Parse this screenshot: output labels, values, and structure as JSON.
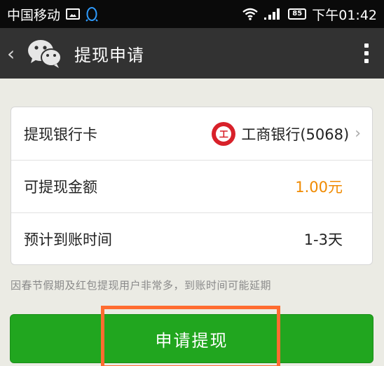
{
  "status_bar": {
    "carrier": "中国移动",
    "battery_level": "85",
    "time": "下午01:42",
    "icons": [
      "image-icon",
      "qq-penguin-icon",
      "wifi-icon",
      "signal-icon",
      "battery-icon"
    ]
  },
  "title_bar": {
    "back": "‹",
    "title": "提现申请",
    "icons": [
      "wechat-logo-icon",
      "more-menu-icon"
    ]
  },
  "form": {
    "bank_card": {
      "label": "提现银行卡",
      "bank_logo_text": "工",
      "value": "工商银行(5068)"
    },
    "available_amount": {
      "label": "可提现金额",
      "value": "1.00元"
    },
    "arrival_time": {
      "label": "预计到账时间",
      "value": "1-3天"
    }
  },
  "notice": "因春节假期及红包提现用户非常多，到账时间可能延期",
  "actions": {
    "withdraw_button": "申请提现"
  },
  "colors": {
    "title_bar": "#323232",
    "status_bar": "#0a0a0a",
    "page_background": "#ebebe4",
    "amount": "#f08a00",
    "button": "#21a61f",
    "highlight": "#ff6c30",
    "bank_logo": "#d8212a"
  }
}
